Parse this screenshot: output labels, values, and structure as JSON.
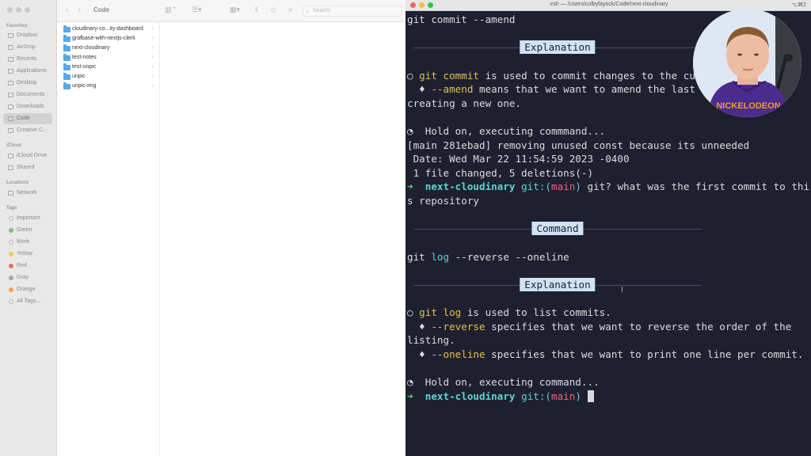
{
  "finder": {
    "title": "Code",
    "search_placeholder": "Search",
    "sidebar": {
      "favorites_label": "Favorites",
      "favorites": [
        "Dropbox",
        "AirDrop",
        "Recents",
        "Applications",
        "Desktop",
        "Documents",
        "Downloads",
        "Code",
        "Creative C..."
      ],
      "active_item": "Code",
      "icloud_label": "iCloud",
      "icloud": [
        "iCloud Drive",
        "Shared"
      ],
      "locations_label": "Locations",
      "locations": [
        "Network"
      ],
      "tags_label": "Tags",
      "tags": [
        {
          "label": "Important",
          "color": "#d0d0d0"
        },
        {
          "label": "Green",
          "color": "#7cc36b"
        },
        {
          "label": "Work",
          "color": "#d0d0d0"
        },
        {
          "label": "Yellow",
          "color": "#f2cd4b"
        },
        {
          "label": "Red",
          "color": "#ef6a61"
        },
        {
          "label": "Gray",
          "color": "#a7a7a7"
        },
        {
          "label": "Orange",
          "color": "#f3a24a"
        },
        {
          "label": "All Tags...",
          "color": "#d0d0d0"
        }
      ]
    },
    "files": [
      "cloudinary-co...ity-dashboard",
      "grafbase-with-nextjs-clerk",
      "next-cloudinary",
      "test-notes",
      "test-unpic",
      "unpic",
      "unpic-img"
    ]
  },
  "terminal": {
    "title": "-zsh — /Users/colbyfayock/Code/next-cloudinary",
    "shortcut": "⌥⌘2",
    "line1": "git commit --amend",
    "header_explanation": "Explanation",
    "header_command": "Command",
    "exp1": {
      "bullet": "○ ",
      "git": "git",
      "cmd": " commit",
      "rest": " is used to commit changes to the cur",
      "opt_bullet": "  ♦ ",
      "opt": "--amend",
      "opt_rest": " means that we want to amend the last c",
      "tail": "creating a new one."
    },
    "executing": "  Hold on, executing commmand...",
    "result1": "[main 281ebad] removing unused const because its unneeded",
    "result2": " Date: Wed Mar 22 11:54:59 2023 -0400",
    "result3": " 1 file changed, 5 deletions(-)",
    "prompt": {
      "arrow": "➜",
      "dir": "next-cloudinary",
      "git": "git:(",
      "branch": "main",
      "close": ")",
      "question_line1": " git? what was the first commit to thi",
      "question_line2": "s repository"
    },
    "command2": {
      "git": "git",
      "cmd": " log",
      "rest": " --reverse --oneline"
    },
    "exp2": {
      "bullet": "○ ",
      "git": "git",
      "cmd": " log",
      "rest": " is used to list commits.",
      "opt1_bullet": "  ♦ ",
      "opt1": "--reverse",
      "opt1_rest": " specifies that we want to reverse the order of the",
      "opt1_tail": "listing.",
      "opt2_bullet": "  ♦ ",
      "opt2": "--oneline",
      "opt2_rest": " specifies that we want to print one line per commit."
    },
    "executing2": "  Hold on, executing command...",
    "clock_icon": "clock-icon"
  },
  "webcam": {
    "shirt_text": "NICKELODEON"
  }
}
